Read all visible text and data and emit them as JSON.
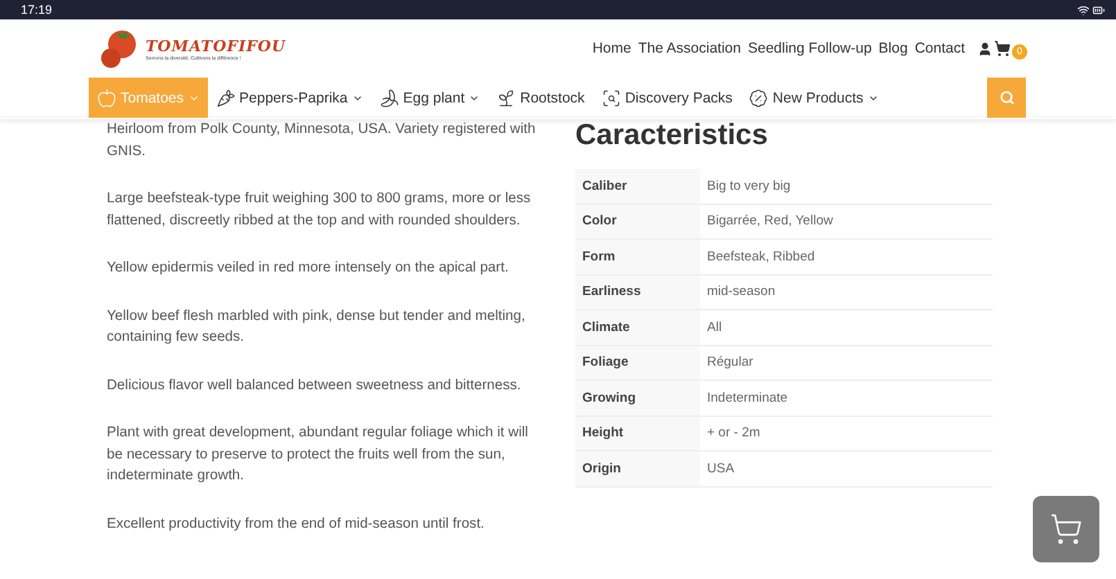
{
  "status_bar": {
    "time": "17:19"
  },
  "logo": {
    "name": "TOMATOFIFOU",
    "tagline": "Semons la diversité, Cultivons la différence !"
  },
  "top_links": [
    "Home",
    "The Association",
    "Seedling Follow-up",
    "Blog",
    "Contact"
  ],
  "cart": {
    "count": "0"
  },
  "nav": [
    {
      "label": "Tomatoes",
      "selected": true,
      "dropdown": true
    },
    {
      "label": "Peppers-Paprika",
      "selected": false,
      "dropdown": true
    },
    {
      "label": "Egg plant",
      "selected": false,
      "dropdown": true
    },
    {
      "label": "Rootstock",
      "selected": false,
      "dropdown": false
    },
    {
      "label": "Discovery Packs",
      "selected": false,
      "dropdown": false
    },
    {
      "label": "New Products",
      "selected": false,
      "dropdown": true
    }
  ],
  "description": [
    "Heirloom from Polk County, Minnesota, USA. Variety registered with GNIS.",
    "Large beefsteak-type fruit weighing 300 to 800 grams, more or less flattened, discreetly ribbed at the top and with rounded shoulders.",
    "Yellow epidermis veiled in red more intensely on the apical part.",
    "Yellow beef flesh marbled with pink, dense but tender and melting, containing few seeds.",
    "Delicious flavor well balanced between sweetness and bitterness.",
    "Plant with great development, abundant regular foliage which it will be necessary to preserve to protect the fruits well from the sun, indeterminate growth.",
    "Excellent productivity from the end of mid-season until frost."
  ],
  "characteristics": {
    "title": "Caracteristics",
    "rows": [
      {
        "label": "Caliber",
        "value": "Big to very big"
      },
      {
        "label": "Color",
        "value": "Bigarrée, Red, Yellow"
      },
      {
        "label": "Form",
        "value": "Beefsteak, Ribbed"
      },
      {
        "label": "Earliness",
        "value": "mid-season"
      },
      {
        "label": "Climate",
        "value": "All"
      },
      {
        "label": "Foliage",
        "value": "Régular"
      },
      {
        "label": "Growing",
        "value": "Indeterminate"
      },
      {
        "label": "Height",
        "value": "+ or - 2m"
      },
      {
        "label": "Origin",
        "value": "USA"
      }
    ]
  }
}
